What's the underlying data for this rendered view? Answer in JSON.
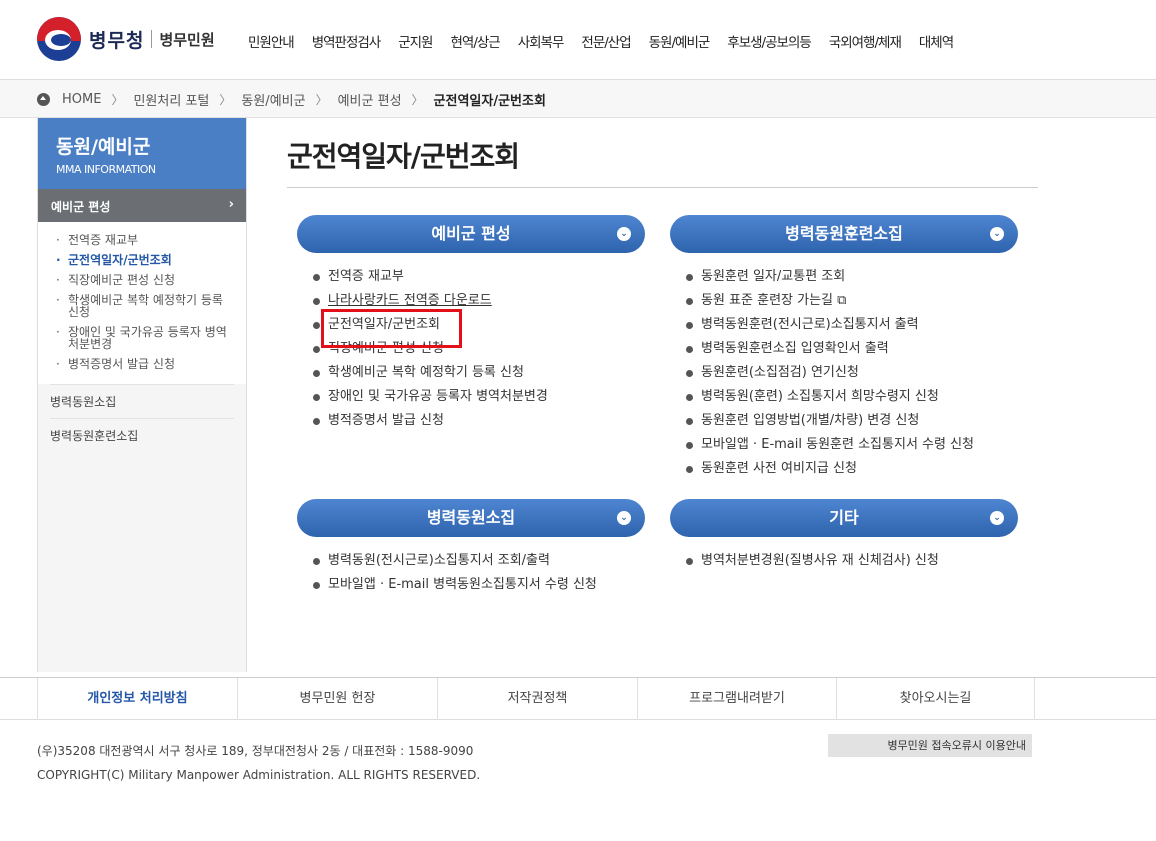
{
  "header": {
    "logo_name": "병무청",
    "logo_sub": "병무민원",
    "nav": [
      "민원안내",
      "병역판정검사",
      "군지원",
      "현역/상근",
      "사회복무",
      "전문/산업",
      "동원/예비군",
      "후보생/공보의등",
      "국외여행/체재",
      "대체역"
    ]
  },
  "breadcrumb": {
    "home": "HOME",
    "items": [
      "민원처리 포털",
      "동원/예비군",
      "예비군 편성"
    ],
    "current": "군전역일자/군번조회"
  },
  "lnb": {
    "title": "동원/예비군",
    "subtitle": "MMA INFORMATION",
    "active": "예비군 편성",
    "sub_items": [
      "전역증 재교부",
      "군전역일자/군번조회",
      "직장예비군 편성 신청",
      "학생예비군 복학 예정학기 등록 신청",
      "장애인 및 국가유공 등록자 병역처분변경",
      "병적증명서 발급 신청"
    ],
    "main_items": [
      "병력동원소집",
      "병력동원훈련소집"
    ]
  },
  "page_title": "군전역일자/군번조회",
  "sections": {
    "reserve": {
      "title": "예비군 편성",
      "links": [
        "전역증 재교부",
        "나라사랑카드 전역증 다운로드",
        "군전역일자/군번조회",
        "직장예비군 편성 신청",
        "학생예비군 복학 예정학기 등록 신청",
        "장애인 및 국가유공 등록자 병역처분변경",
        "병적증명서 발급 신청"
      ]
    },
    "training": {
      "title": "병력동원훈련소집",
      "links": [
        "동원훈련 일자/교통편 조회",
        "동원 표준 훈련장 가는길 ⧉",
        "병력동원훈련(전시근로)소집통지서 출력",
        "병력동원훈련소집 입영확인서 출력",
        "동원훈련(소집점검) 연기신청",
        "병력동원(훈련) 소집통지서 희망수령지 신청",
        "동원훈련 입영방법(개별/차량) 변경 신청",
        "모바일앱 · E-mail 동원훈련 소집통지서 수령 신청",
        "동원훈련 사전 여비지급 신청"
      ]
    },
    "mobilization": {
      "title": "병력동원소집",
      "links": [
        "병력동원(전시근로)소집통지서 조회/출력",
        "모바일앱 · E-mail 병력동원소집통지서 수령 신청"
      ]
    },
    "other": {
      "title": "기타",
      "links": [
        "병역처분변경원(질병사유 재 신체검사) 신청"
      ]
    }
  },
  "footer": {
    "nav": [
      "개인정보 처리방침",
      "병무민원 헌장",
      "저작권정책",
      "프로그램내려받기",
      "찾아오시는길"
    ],
    "address": "(우)35208 대전광역시 서구 청사로 189, 정부대전청사 2동 / 대표전화 : 1588-9090",
    "copyright": "COPYRIGHT(C) Military Manpower Administration. ALL RIGHTS RESERVED.",
    "error_button": "병무민원 접속오류시 이용안내"
  },
  "colors": {
    "accent": "#2e63ad",
    "lnb_header": "#4a7fc6",
    "highlight": "#e3101a"
  }
}
